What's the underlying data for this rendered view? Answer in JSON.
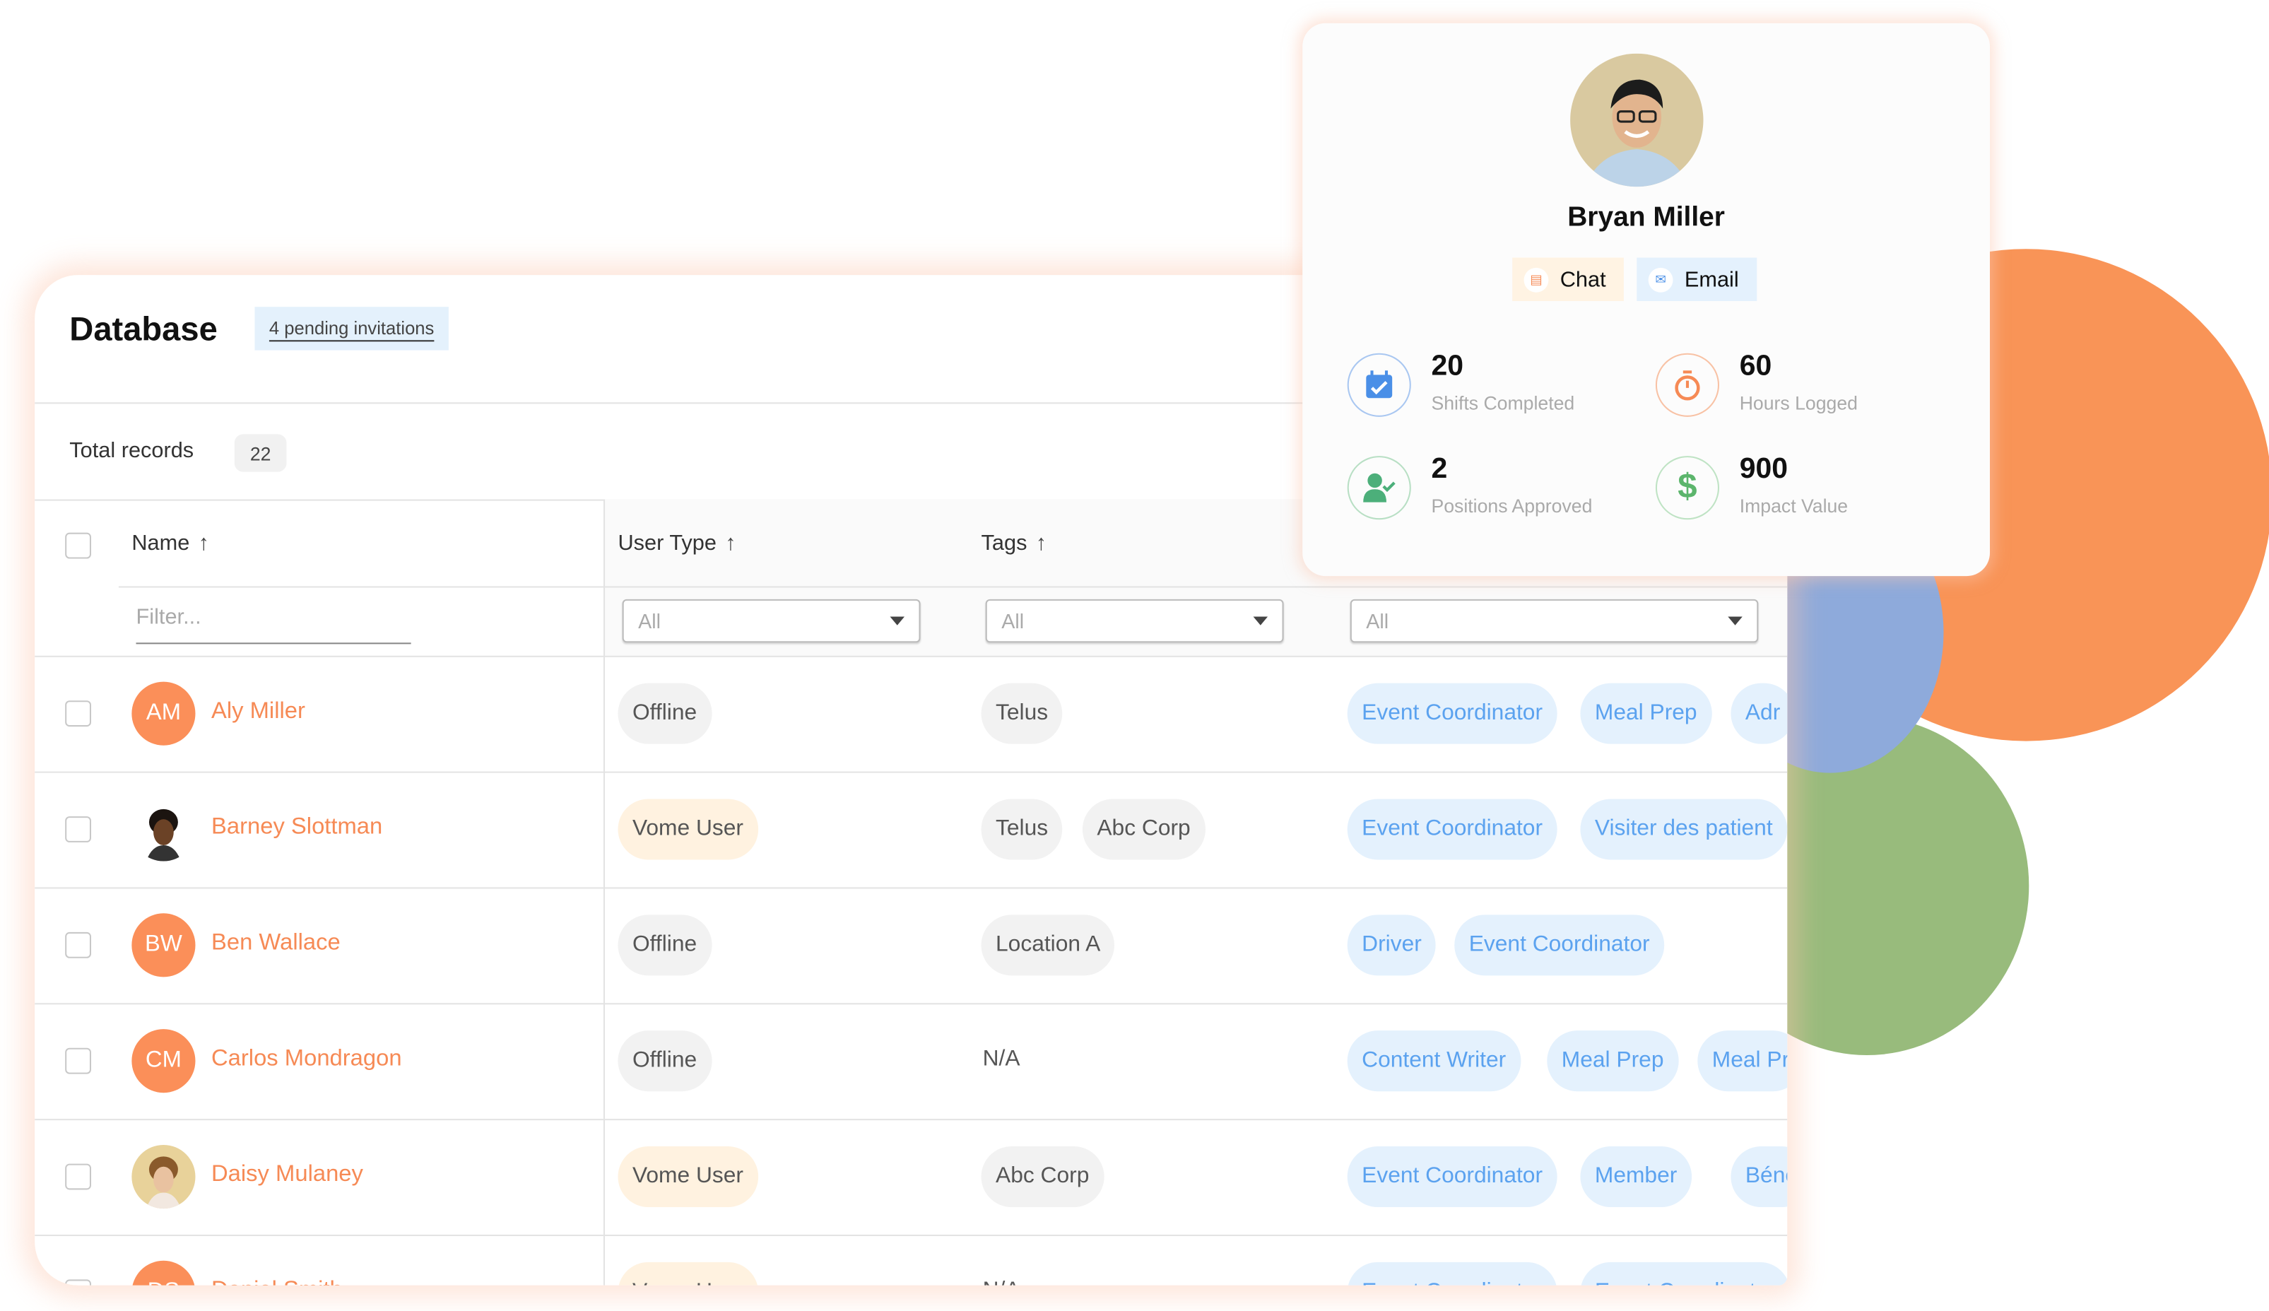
{
  "colors": {
    "accent_orange": "#f68a55",
    "avatar_orange": "#fb8f59",
    "role_blue": "#5ba2ef",
    "role_bg": "#e4f1fd",
    "deco_orange": "#f99457",
    "deco_blue": "#8eaadb",
    "deco_green": "#98bb7c"
  },
  "database": {
    "title": "Database",
    "pending_label": "4 pending invitations",
    "total_label": "Total records",
    "total_count": "22",
    "columns": [
      {
        "label": "Name",
        "sort": "arrow-up-icon"
      },
      {
        "label": "User Type",
        "sort": "arrow-up-icon"
      },
      {
        "label": "Tags",
        "sort": "arrow-up-icon"
      }
    ],
    "filter_placeholder": "Filter...",
    "selects": [
      "All",
      "All",
      "All"
    ],
    "rows": [
      {
        "initials": "AM",
        "name": "Aly Miller",
        "user_type": "Offline",
        "tags": [
          "Telus"
        ],
        "roles": [
          "Event Coordinator",
          "Meal Prep",
          "Adr"
        ]
      },
      {
        "initials": "",
        "avatar": "photo",
        "name": "Barney Slottman",
        "user_type": "Vome User",
        "tags": [
          "Telus",
          "Abc Corp"
        ],
        "roles": [
          "Event Coordinator",
          "Visiter des patient"
        ]
      },
      {
        "initials": "BW",
        "name": "Ben Wallace",
        "user_type": "Offline",
        "tags": [
          "Location A"
        ],
        "roles": [
          "Driver",
          "Event Coordinator"
        ]
      },
      {
        "initials": "CM",
        "name": "Carlos Mondragon",
        "user_type": "Offline",
        "tags": [],
        "tags_empty": "N/A",
        "roles": [
          "Content Writer",
          "Meal Prep",
          "Meal Pr"
        ]
      },
      {
        "initials": "",
        "avatar": "photo",
        "name": "Daisy Mulaney",
        "user_type": "Vome User",
        "tags": [
          "Abc Corp"
        ],
        "roles": [
          "Event Coordinator",
          "Member",
          "Béné"
        ]
      },
      {
        "initials": "DS",
        "name": "Daniel Smith",
        "user_type": "Vome User",
        "tags": [],
        "tags_empty": "N/A",
        "roles": [
          "Event Coordinator",
          "Event Coordinator"
        ]
      }
    ]
  },
  "profile": {
    "name": "Bryan Miller",
    "chat_label": "Chat",
    "email_label": "Email",
    "stats": [
      {
        "value": "20",
        "label": "Shifts Completed",
        "icon": "calendar-check-icon",
        "color": "#4a8fe7"
      },
      {
        "value": "60",
        "label": "Hours Logged",
        "icon": "stopwatch-icon",
        "color": "#f68a55"
      },
      {
        "value": "2",
        "label": "Positions Approved",
        "icon": "user-check-icon",
        "color": "#4caf7a"
      },
      {
        "value": "900",
        "label": "Impact Value",
        "icon": "dollar-icon",
        "color": "#5cb56c"
      }
    ]
  }
}
